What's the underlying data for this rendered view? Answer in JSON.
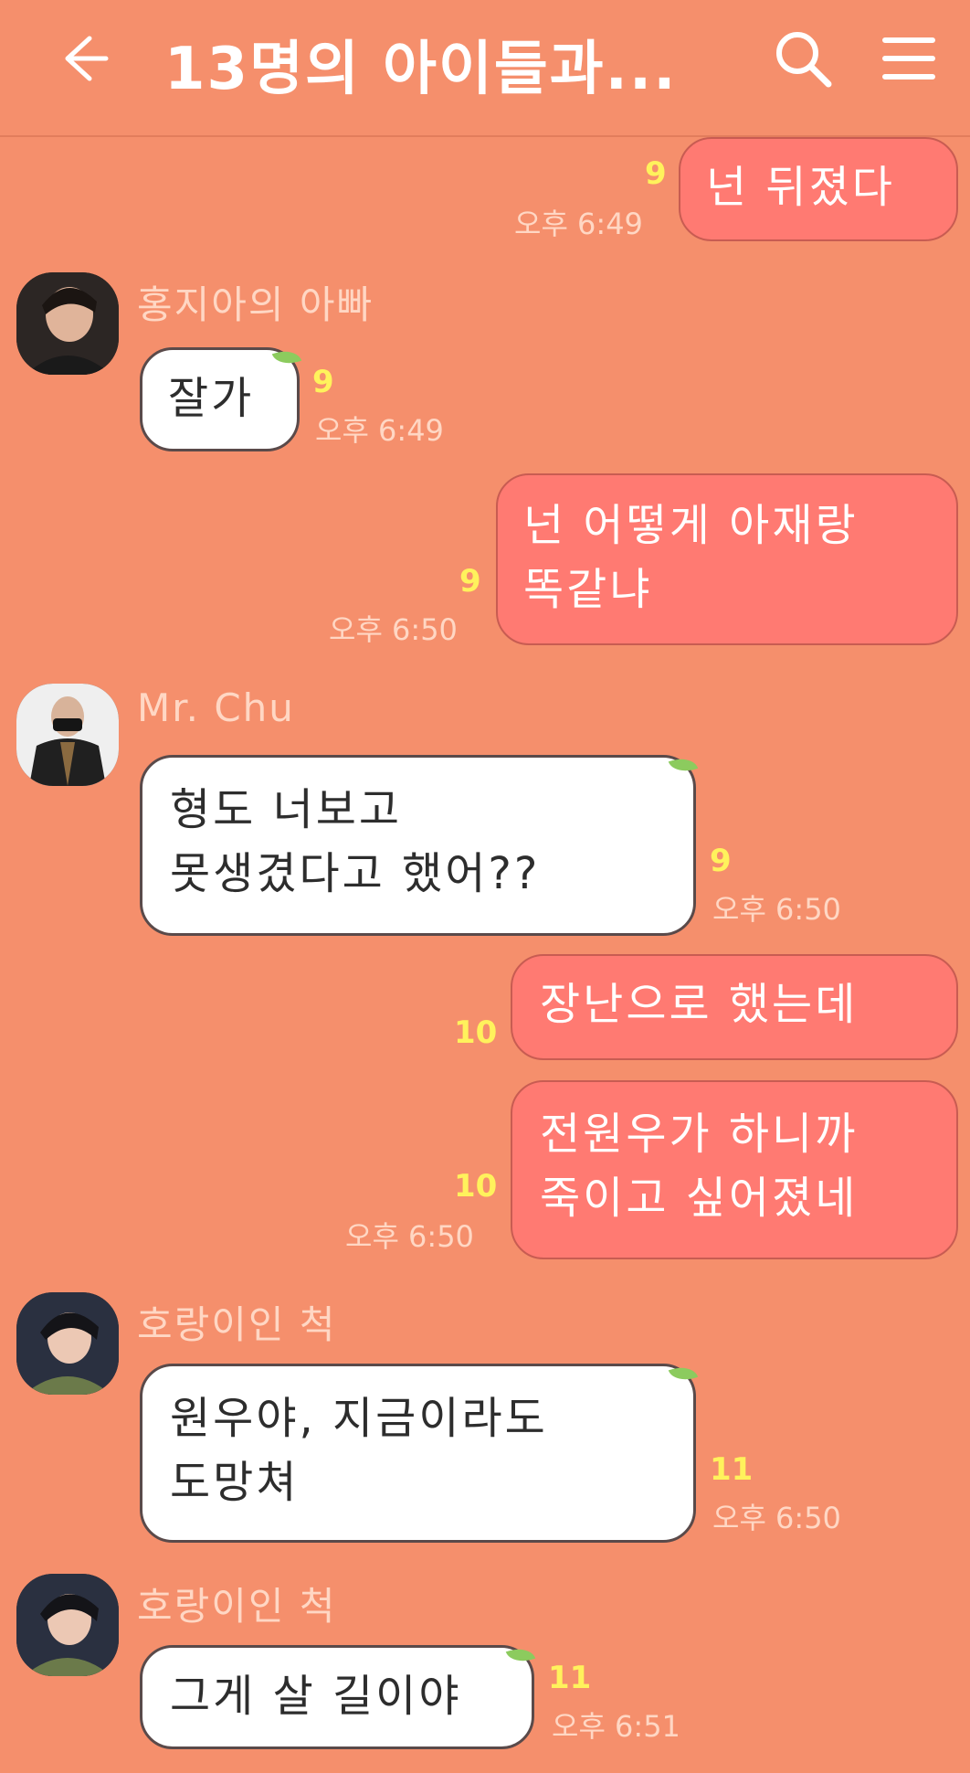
{
  "header": {
    "title": "13명의 아이들과...",
    "back_icon": "arrow-left-icon",
    "search_icon": "search-icon",
    "menu_icon": "hamburger-menu-icon"
  },
  "messages": [
    {
      "side": "me",
      "lines": [
        "넌 뒤졌다"
      ],
      "count": "9",
      "time": "오후 6:49"
    },
    {
      "side": "other",
      "sender": "홍지아의 아빠",
      "lines": [
        "잘가"
      ],
      "count": "9",
      "time": "오후 6:49"
    },
    {
      "side": "me",
      "lines": [
        "넌 어떻게 아재랑",
        "똑같냐"
      ],
      "count": "9",
      "time": "오후 6:50"
    },
    {
      "side": "other",
      "sender": "Mr. Chu",
      "lines": [
        "형도 너보고",
        "못생겼다고 했어??"
      ],
      "count": "9",
      "time": "오후 6:50"
    },
    {
      "side": "me",
      "lines": [
        "장난으로 했는데"
      ],
      "count": "10",
      "time": ""
    },
    {
      "side": "me",
      "lines": [
        "전원우가 하니까",
        "죽이고 싶어졌네"
      ],
      "count": "10",
      "time": "오후 6:50"
    },
    {
      "side": "other",
      "sender": "호랑이인 척",
      "lines": [
        "원우야, 지금이라도",
        "도망쳐"
      ],
      "count": "11",
      "time": "오후 6:50"
    },
    {
      "side": "other",
      "sender": "호랑이인 척",
      "lines": [
        "그게 살 길이야"
      ],
      "count": "11",
      "time": "오후 6:51"
    }
  ],
  "colors": {
    "background": "#F58F6C",
    "my_bubble": "#FF7A72",
    "other_bubble": "#FFFFFF",
    "read_count": "#FFF25C",
    "meta_text": "#FFD7C4"
  }
}
